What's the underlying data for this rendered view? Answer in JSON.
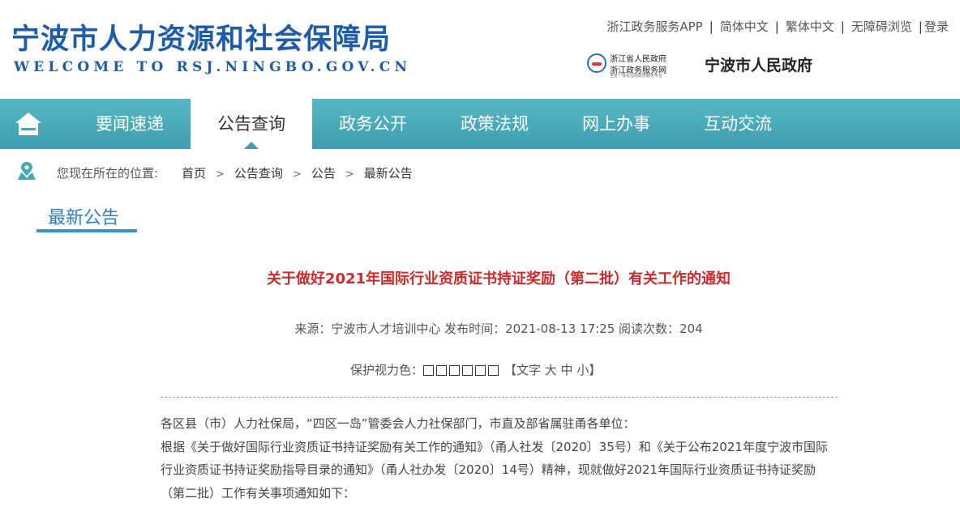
{
  "header": {
    "title": "宁波市人力资源和社会保障局",
    "subtitle": "WELCOME TO RSJ.NINGBO.GOV.CN",
    "top_links": [
      "浙江政务服务APP",
      "简体中文",
      "繁体中文",
      "无障碍浏览",
      "登录"
    ],
    "logo_zj": {
      "line1": "浙江省人民政府",
      "line2": "浙江政务服务网",
      "line3": "全省一体化在线政务服务平台"
    },
    "logo_nb": "宁波市人民政府"
  },
  "nav": {
    "items": [
      "要闻速递",
      "公告查询",
      "政务公开",
      "政策法规",
      "网上办事",
      "互动交流"
    ],
    "active_index": 1
  },
  "breadcrumb": {
    "label": "您现在所在的位置:",
    "items": [
      "首页",
      "公告查询",
      "公告",
      "最新公告"
    ]
  },
  "section_title": "最新公告",
  "article": {
    "title": "关于做好2021年国际行业资质证书持证奖励（第二批）有关工作的通知",
    "meta": "来源：宁波市人才培训中心 发布时间：2021-08-13 17:25 阅读次数：204",
    "protect_label": "保护视力色：",
    "swatch_count": 6,
    "font_size_label": "【文字 大 中 小】",
    "paragraphs": [
      "各区县（市）人力社保局，“四区一岛”管委会人力社保部门，市直及部省属驻甬各单位：",
      "根据《关于做好国际行业资质证书持证奖励有关工作的通知》（甬人社发〔2020〕35号）和《关于公布2021年度宁波市国际行业资质证书持证奖励指导目录的通知》（甬人社办发〔2020〕14号）精神，现就做好2021年国际行业资质证书持证奖励（第二批）工作有关事项通知如下："
    ]
  },
  "colors": {
    "nav": "#4aadbd",
    "title_blue": "#1f5ca8",
    "article_red": "#cc2a2a",
    "section_blue": "#2f7fc1"
  }
}
